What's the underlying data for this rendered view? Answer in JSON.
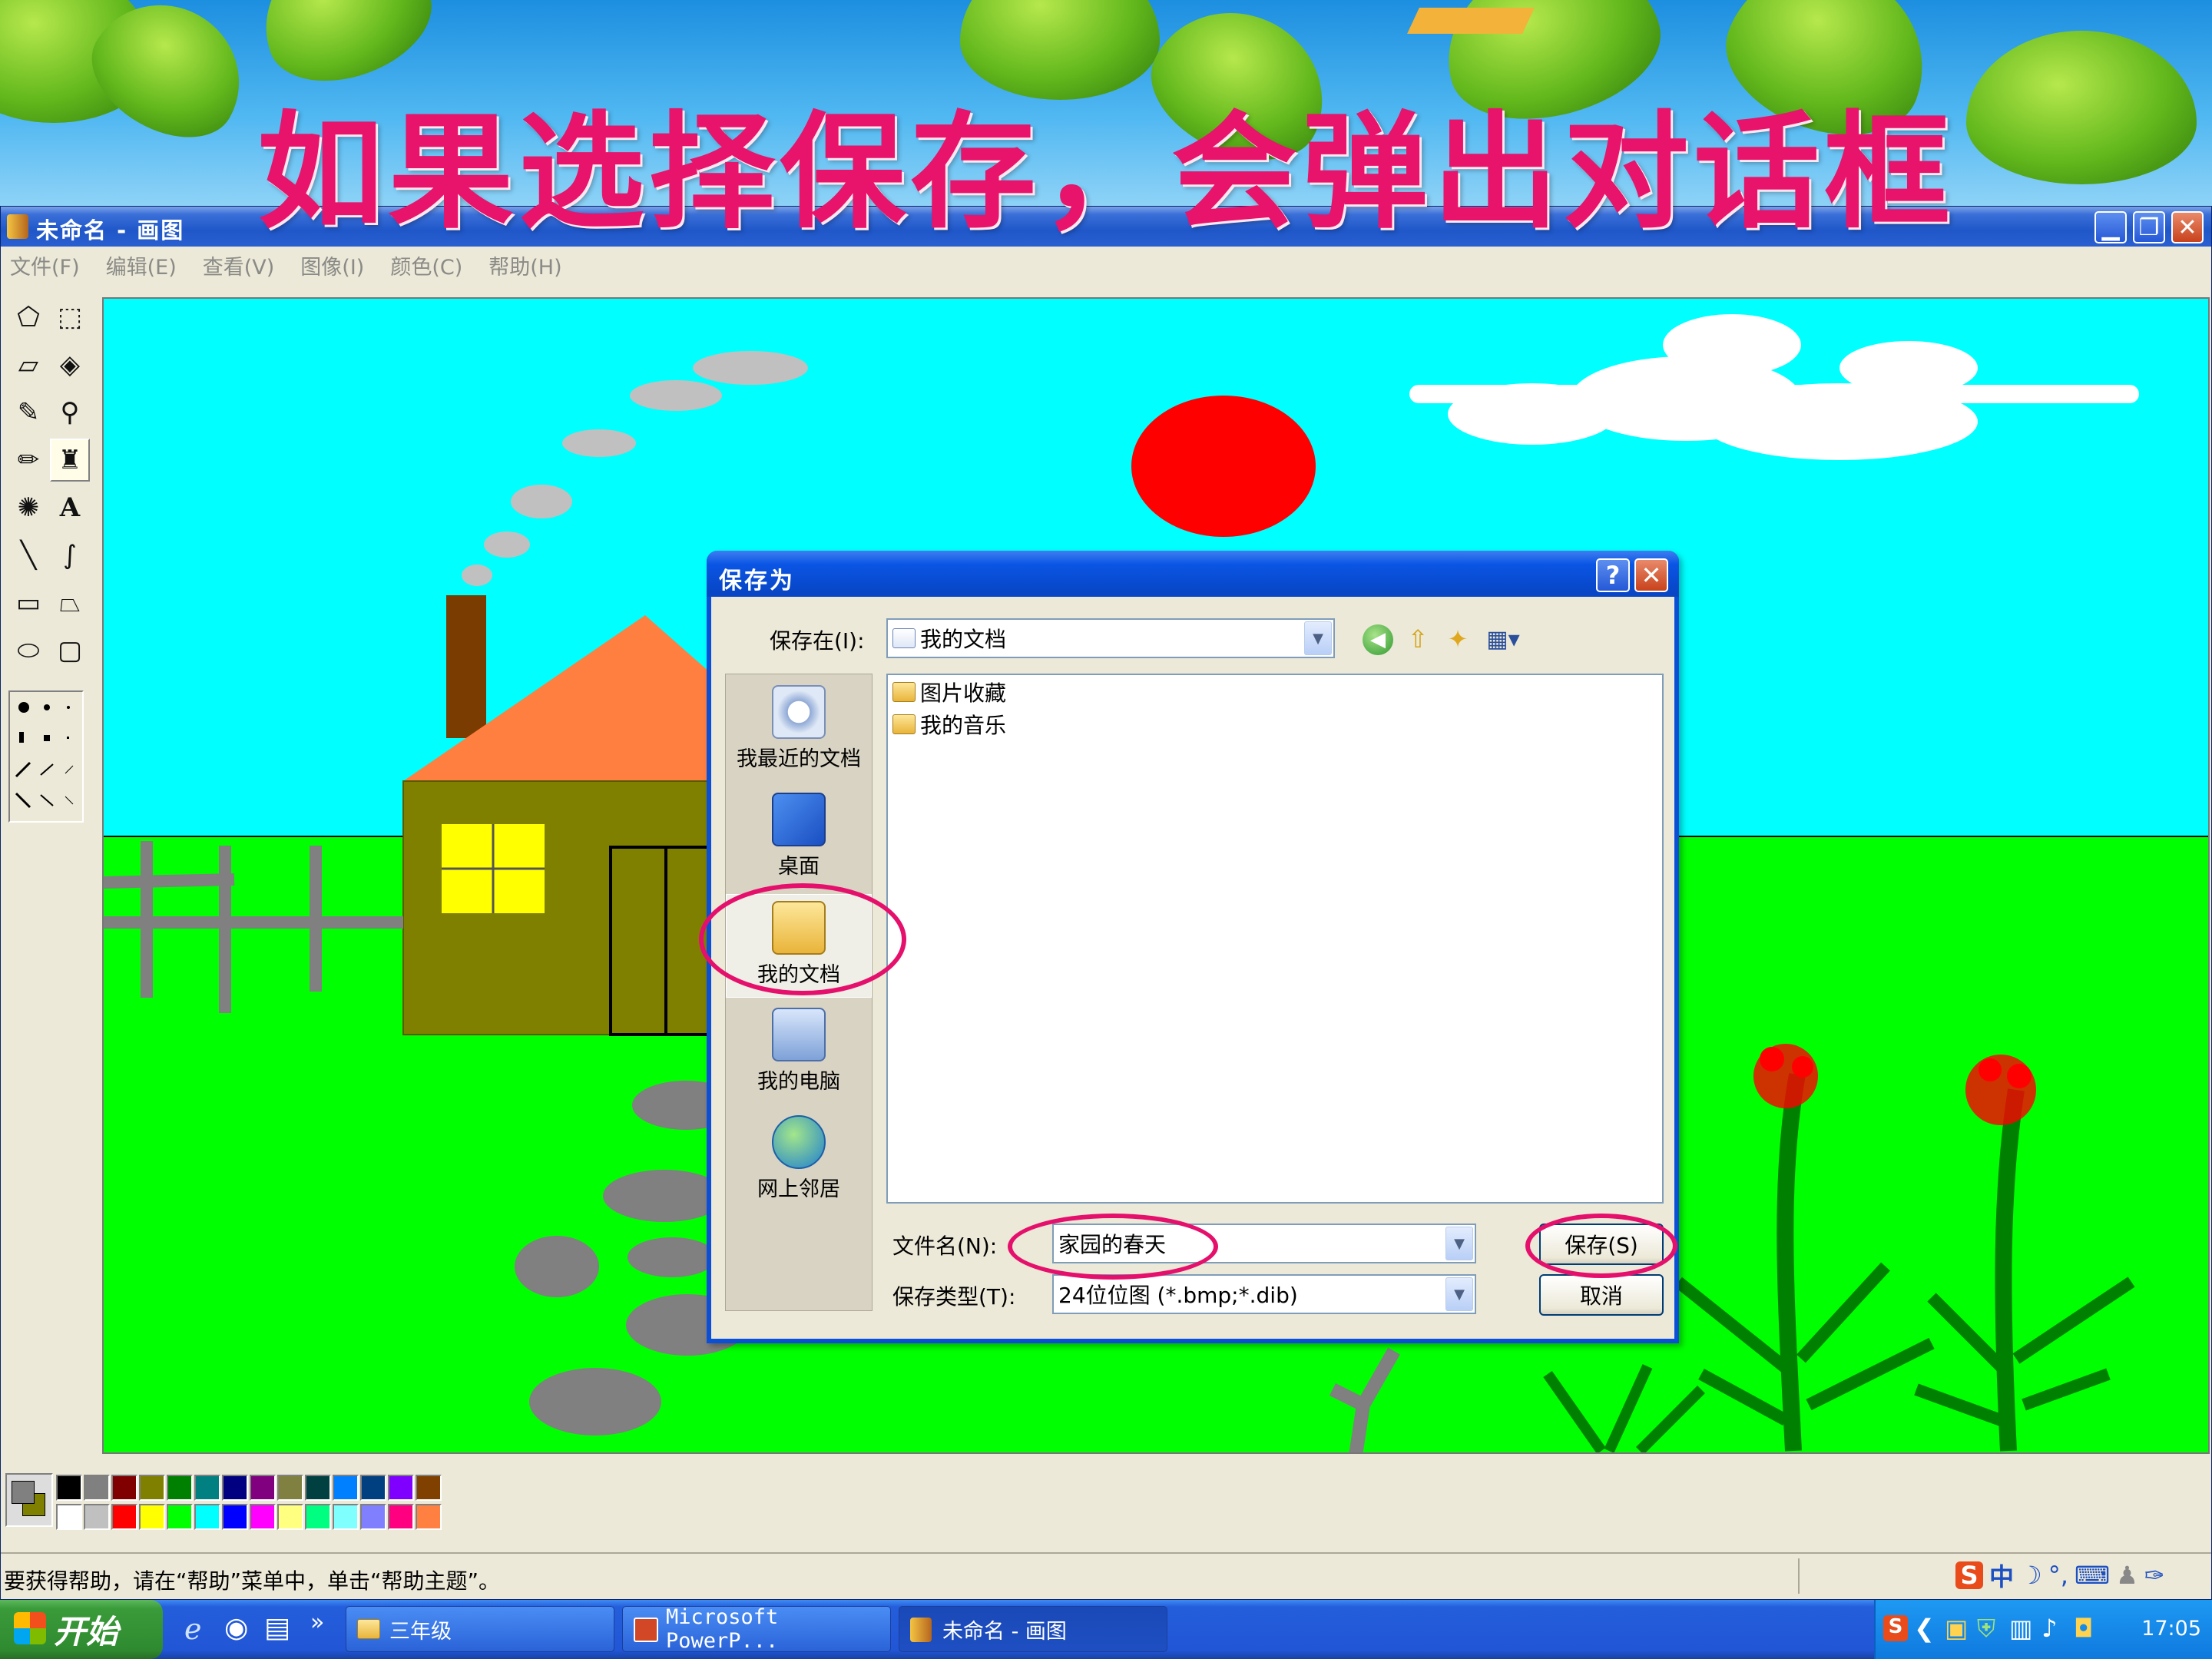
{
  "headline": "如果选择保存，会弹出对话框",
  "window": {
    "title": "未命名 - 画图",
    "menu": [
      "文件(F)",
      "编辑(E)",
      "查看(V)",
      "图像(I)",
      "颜色(C)",
      "帮助(H)"
    ]
  },
  "toolbox": {
    "tools": [
      "free-select",
      "select",
      "eraser",
      "fill",
      "picker",
      "magnifier",
      "pencil",
      "brush",
      "airbrush",
      "text",
      "line",
      "curve",
      "rectangle",
      "polygon",
      "ellipse",
      "rounded-rectangle"
    ],
    "selected": "brush"
  },
  "palette": [
    "#000000",
    "#808080",
    "#800000",
    "#808000",
    "#008000",
    "#008080",
    "#000080",
    "#800080",
    "#808040",
    "#004040",
    "#0080ff",
    "#004080",
    "#8000ff",
    "#804000",
    "#ffffff",
    "#c0c0c0",
    "#ff0000",
    "#ffff00",
    "#00ff00",
    "#00ffff",
    "#0000ff",
    "#ff00ff",
    "#ffff80",
    "#00ff80",
    "#80ffff",
    "#8080ff",
    "#ff0080",
    "#ff8040"
  ],
  "status_text": "要获得帮助，请在“帮助”菜单中，单击“帮助主题”。",
  "dialog": {
    "title": "保存为",
    "save_in_label": "保存在(I):",
    "save_in_value": "我的文档",
    "places": [
      "我最近的文档",
      "桌面",
      "我的文档",
      "我的电脑",
      "网上邻居"
    ],
    "files": [
      "图片收藏",
      "我的音乐"
    ],
    "filename_label": "文件名(N):",
    "filename_value": "家园的春天",
    "filetype_label": "保存类型(T):",
    "filetype_value": "24位位图 (*.bmp;*.dib)",
    "save_button": "保存(S)",
    "cancel_button": "取消"
  },
  "taskbar": {
    "start": "开始",
    "tasks": [
      "三年级",
      "Microsoft PowerP...",
      "未命名 - 画图"
    ],
    "clock": "17:05"
  },
  "ime": "中",
  "colors": {
    "highlight_ring": "#e5106c",
    "xp_blue": "#0a55e4",
    "headline": "#e8136a"
  }
}
